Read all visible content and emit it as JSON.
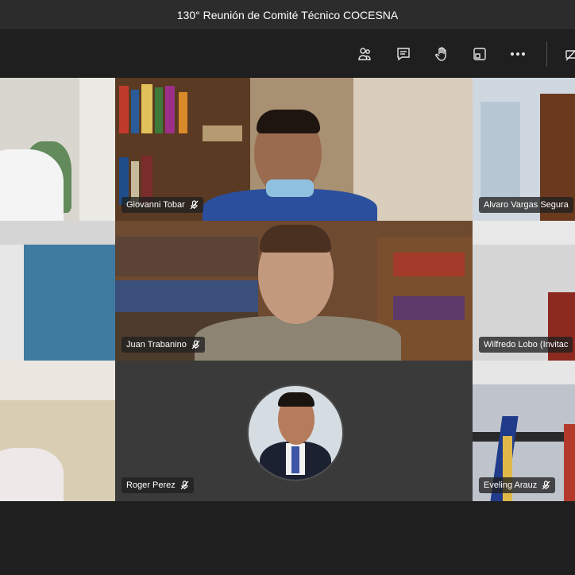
{
  "window": {
    "title": "130° Reunión de Comité Técnico COCESNA"
  },
  "toolbar": {
    "buttons": [
      {
        "icon": "participants-icon"
      },
      {
        "icon": "chat-icon"
      },
      {
        "icon": "raise-hand-icon"
      },
      {
        "icon": "share-screen-icon"
      },
      {
        "icon": "more-options-icon"
      },
      {
        "icon": "video-icon"
      }
    ]
  },
  "participants": [
    {
      "name": "Giovanni Tobar",
      "muted": true
    },
    {
      "name": "Alvaro Vargas Segura",
      "muted": false
    },
    {
      "name": "Juan Trabanino",
      "muted": true
    },
    {
      "name": "Wilfredo Lobo (Invitac",
      "muted": false
    },
    {
      "name": "Roger Perez",
      "muted": true
    },
    {
      "name": "Eveling Arauz",
      "muted": true
    }
  ],
  "colors": {
    "background": "#201f1f",
    "titlebar": "#2d2c2c",
    "tile_idle": "#3b3a3a"
  }
}
